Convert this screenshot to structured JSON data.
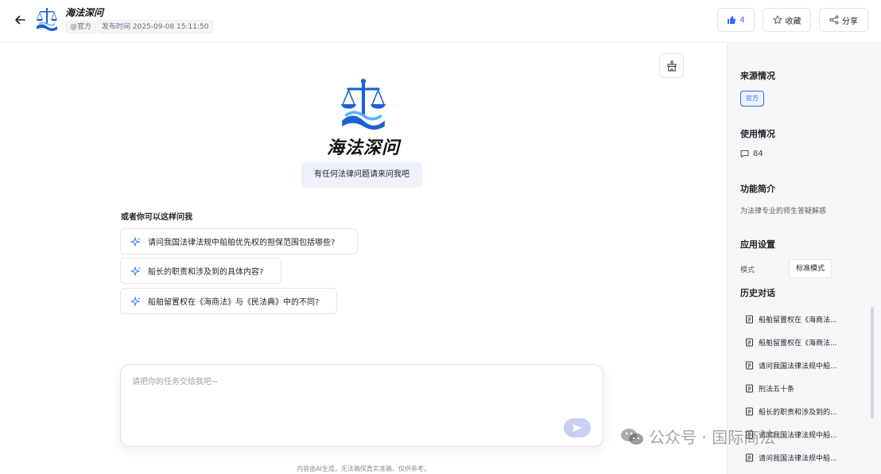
{
  "header": {
    "title": "海法深问",
    "tags": {
      "official": "@官方",
      "publish_time": "发布时间 2025-09-08 15:11:50"
    },
    "like_count": "4",
    "favorite_label": "收藏",
    "share_label": "分享"
  },
  "main": {
    "title": "海法深问",
    "subtitle": "有任何法律问题请来问我吧",
    "suggest_title": "或者你可以这样问我",
    "suggestions": [
      "请问我国法律法规中船舶优先权的担保范围包括哪些?",
      "船长的职责和涉及到的具体内容?",
      "船舶留置权在《海商法》与《民法典》中的不同?"
    ],
    "input_placeholder": "请把你的任务交给我吧~",
    "disclaimer": "内容由AI生成，无法确保真实准确，仅供参考。"
  },
  "sidebar": {
    "source_title": "来源情况",
    "source_badge": "官方",
    "usage_title": "使用情况",
    "usage_count": "84",
    "intro_title": "功能简介",
    "intro_text": "为法律专业的师生答疑解惑",
    "settings_title": "应用设置",
    "mode_label": "模式",
    "mode_value": "标准模式",
    "history_title": "历史对话",
    "history": [
      "船舶留置权在《海商法...",
      "船舶留置权在《海商法...",
      "请问我国法律法规中船...",
      "刑法五十条",
      "船长的职责和涉及到的...",
      "请问我国法律法规中船...",
      "请问我国法律法规中船..."
    ]
  },
  "watermark": {
    "text": "公众号 · 国际商法"
  },
  "colors": {
    "accent": "#2f6bf5",
    "logo_blue": "#1e5fd6",
    "send_button": "#c7cff5"
  }
}
